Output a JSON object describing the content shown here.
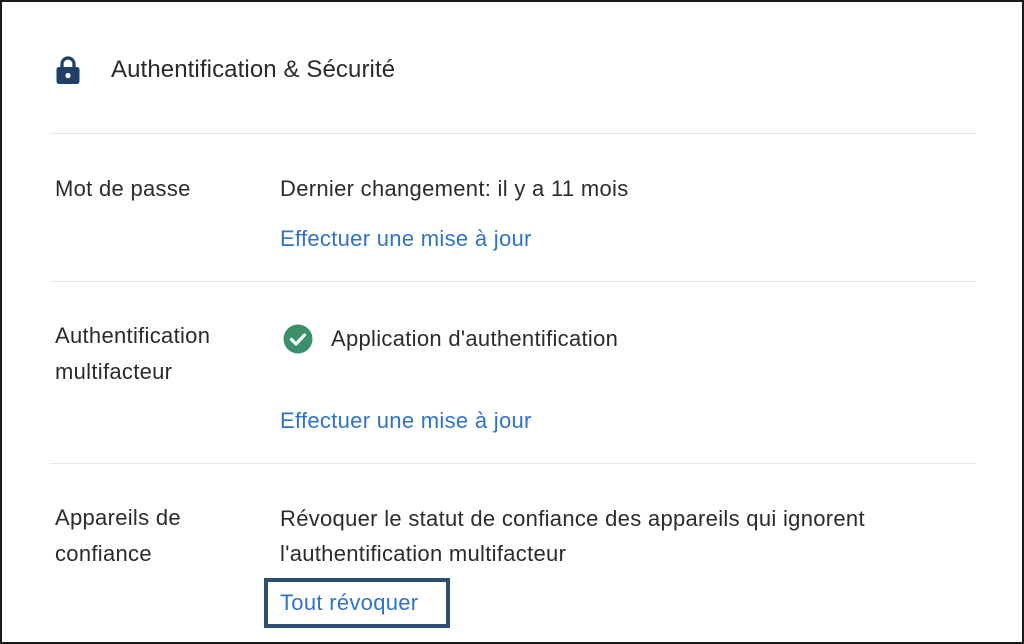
{
  "header": {
    "icon": "lock-icon",
    "title": "Authentification & Sécurité"
  },
  "rows": [
    {
      "label": "Mot de passe",
      "text": "Dernier changement: il y a 11 mois",
      "link": "Effectuer une mise à jour"
    },
    {
      "label_lines": [
        "Authentification",
        "multifacteur"
      ],
      "status_icon": "check-circle-icon",
      "status": "Application d'authentification",
      "link": "Effectuer une mise à jour"
    },
    {
      "label_lines": [
        "Appareils de",
        "confiance"
      ],
      "text_lines": [
        "Révoquer le statut de confiance des appareils qui ignorent",
        "l'authentification multifacteur"
      ],
      "link": "Tout révoquer"
    }
  ],
  "colors": {
    "accent_link": "#2f73c9",
    "lock": "#1f3f66",
    "success": "#3b8f6a",
    "focus_border": "#2c4f72"
  }
}
